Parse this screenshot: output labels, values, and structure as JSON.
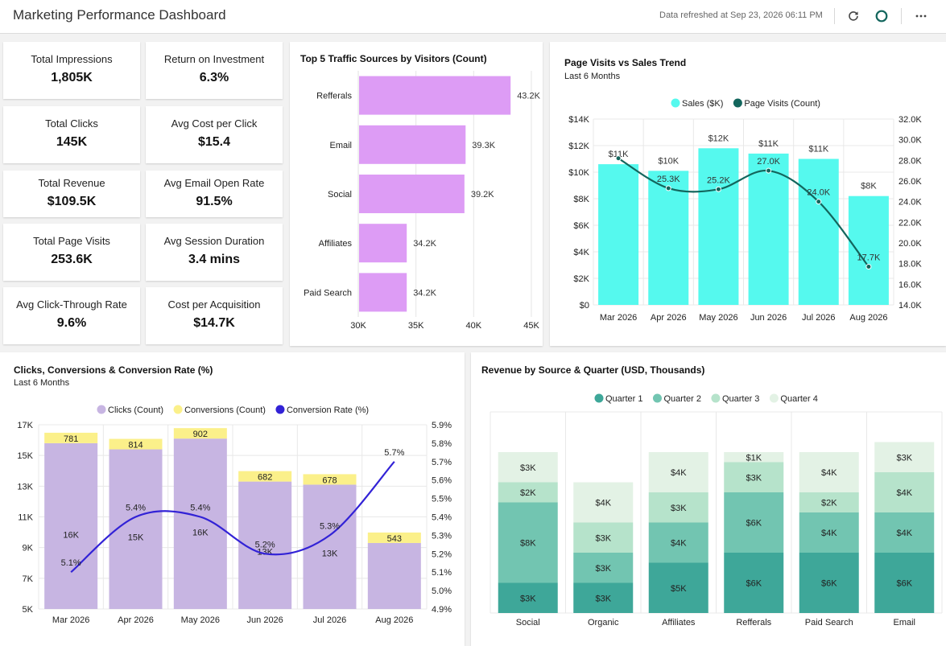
{
  "header": {
    "title": "Marketing Performance Dashboard",
    "refreshed": "Data refreshed at Sep 23, 2026 06:11 PM"
  },
  "colors": {
    "bar_purple": "#dd9cf5",
    "sales_cyan": "#55f9ee",
    "visits_line": "#13665d",
    "clicks_bar": "#c7b5e2",
    "conversions_bar": "#fbf08a",
    "rate_line": "#3222d6",
    "q1": "#3ea799",
    "q2": "#72c5b1",
    "q3": "#b6e3cb",
    "q4": "#e3f2e5"
  },
  "kpis": [
    {
      "label": "Total Impressions",
      "value": "1,805K"
    },
    {
      "label": "Return on Investment",
      "value": "6.3%"
    },
    {
      "label": "Total Clicks",
      "value": "145K"
    },
    {
      "label": "Avg Cost per Click",
      "value": "$15.4"
    },
    {
      "label": "Total Revenue",
      "value": "$109.5K"
    },
    {
      "label": "Avg Email Open Rate",
      "value": "91.5%"
    },
    {
      "label": "Total Page Visits",
      "value": "253.6K"
    },
    {
      "label": "Avg Session Duration",
      "value": "3.4 mins"
    },
    {
      "label": "Avg Click-Through Rate",
      "value": "9.6%"
    },
    {
      "label": "Cost per Acquisition",
      "value": "$14.7K"
    }
  ],
  "chart_data": [
    {
      "id": "traffic",
      "type": "bar",
      "orientation": "horizontal",
      "title": "Top 5 Traffic Sources by Visitors (Count)",
      "categories": [
        "Refferals",
        "Email",
        "Social",
        "Affiliates",
        "Paid Search"
      ],
      "values": [
        43200,
        39300,
        39200,
        34200,
        34200
      ],
      "value_labels": [
        "43.2K",
        "39.3K",
        "39.2K",
        "34.2K",
        "34.2K"
      ],
      "xlim": [
        30000,
        45000
      ],
      "x_ticks": [
        30000,
        35000,
        40000,
        45000
      ],
      "x_tick_labels": [
        "30K",
        "35K",
        "40K",
        "45K"
      ],
      "grid": true
    },
    {
      "id": "visits",
      "type": "bar",
      "title": "Page Visits vs Sales Trend",
      "subtitle": "Last 6 Months",
      "categories": [
        "Mar 2026",
        "Apr 2026",
        "May 2026",
        "Jun 2026",
        "Jul 2026",
        "Aug 2026"
      ],
      "series": [
        {
          "name": "Sales ($K)",
          "type": "bar",
          "axis": "left",
          "values": [
            10.6,
            10.1,
            11.8,
            11.4,
            11.0,
            8.2
          ],
          "labels": [
            "$11K",
            "$10K",
            "$12K",
            "$11K",
            "$11K",
            "$8K"
          ]
        },
        {
          "name": "Page Visits (Count)",
          "type": "line",
          "axis": "right",
          "values": [
            28.2,
            25.3,
            25.2,
            27.0,
            24.0,
            17.7
          ],
          "labels": [
            "",
            "25.3K",
            "25.2K",
            "27.0K",
            "24.0K",
            "17.7K"
          ]
        }
      ],
      "ylim": [
        0,
        14
      ],
      "y_tick_labels": [
        "$0",
        "$2K",
        "$4K",
        "$6K",
        "$8K",
        "$10K",
        "$12K",
        "$14K"
      ],
      "y2lim": [
        14,
        32
      ],
      "y2_tick_labels": [
        "14.0K",
        "16.0K",
        "18.0K",
        "20.0K",
        "22.0K",
        "24.0K",
        "26.0K",
        "28.0K",
        "30.0K",
        "32.0K"
      ],
      "legend": "top-center",
      "grid": true
    },
    {
      "id": "clicks",
      "type": "bar",
      "title": "Clicks, Conversions & Conversion Rate (%)",
      "subtitle": "Last 6 Months",
      "categories": [
        "Mar 2026",
        "Apr 2026",
        "May 2026",
        "Jun 2026",
        "Jul 2026",
        "Aug 2026"
      ],
      "series": [
        {
          "name": "Clicks (Count)",
          "type": "bar",
          "stack": "a",
          "axis": "left",
          "values": [
            15800,
            15400,
            16100,
            13300,
            13100,
            9300
          ],
          "labels": [
            "16K",
            "15K",
            "16K",
            "13K",
            "13K",
            ""
          ]
        },
        {
          "name": "Conversions (Count)",
          "type": "bar",
          "stack": "a",
          "axis": "left",
          "values": [
            781,
            814,
            902,
            682,
            678,
            543
          ],
          "labels": [
            "781",
            "814",
            "902",
            "682",
            "678",
            "543"
          ]
        },
        {
          "name": "Conversion Rate (%)",
          "type": "line",
          "axis": "right",
          "values": [
            5.1,
            5.4,
            5.4,
            5.2,
            5.3,
            5.7
          ],
          "labels": [
            "5.1%",
            "5.4%",
            "5.4%",
            "5.2%",
            "5.3%",
            "5.7%"
          ]
        }
      ],
      "ylim": [
        5000,
        17000
      ],
      "y_ticks": [
        5000,
        7000,
        9000,
        11000,
        13000,
        15000,
        17000
      ],
      "y_tick_labels": [
        "5K",
        "7K",
        "9K",
        "11K",
        "13K",
        "15K",
        "17K"
      ],
      "y2lim": [
        4.9,
        5.9
      ],
      "y2_tick_labels": [
        "4.9%",
        "5.0%",
        "5.1%",
        "5.2%",
        "5.3%",
        "5.4%",
        "5.5%",
        "5.6%",
        "5.7%",
        "5.8%",
        "5.9%"
      ],
      "legend": "top-center",
      "grid": true
    },
    {
      "id": "revenue",
      "type": "bar",
      "stacked": true,
      "title": "Revenue by Source & Quarter (USD, Thousands)",
      "categories": [
        "Social",
        "Organic",
        "Affiliates",
        "Refferals",
        "Paid Search",
        "Email"
      ],
      "series": [
        {
          "name": "Quarter 1",
          "values": [
            3,
            3,
            5,
            6,
            6,
            6
          ],
          "labels": [
            "$3K",
            "$3K",
            "$5K",
            "$6K",
            "$6K",
            "$6K"
          ]
        },
        {
          "name": "Quarter 2",
          "values": [
            8,
            3,
            4,
            6,
            4,
            4
          ],
          "labels": [
            "$8K",
            "$3K",
            "$4K",
            "$6K",
            "$4K",
            "$4K"
          ]
        },
        {
          "name": "Quarter 3",
          "values": [
            2,
            3,
            3,
            3,
            2,
            4
          ],
          "labels": [
            "$2K",
            "$3K",
            "$3K",
            "$3K",
            "$2K",
            "$4K"
          ]
        },
        {
          "name": "Quarter 4",
          "values": [
            3,
            4,
            4,
            1,
            4,
            3
          ],
          "labels": [
            "$3K",
            "$4K",
            "$4K",
            "$1K",
            "$4K",
            "$3K"
          ]
        }
      ],
      "legend": "top-center",
      "grid": true
    }
  ]
}
